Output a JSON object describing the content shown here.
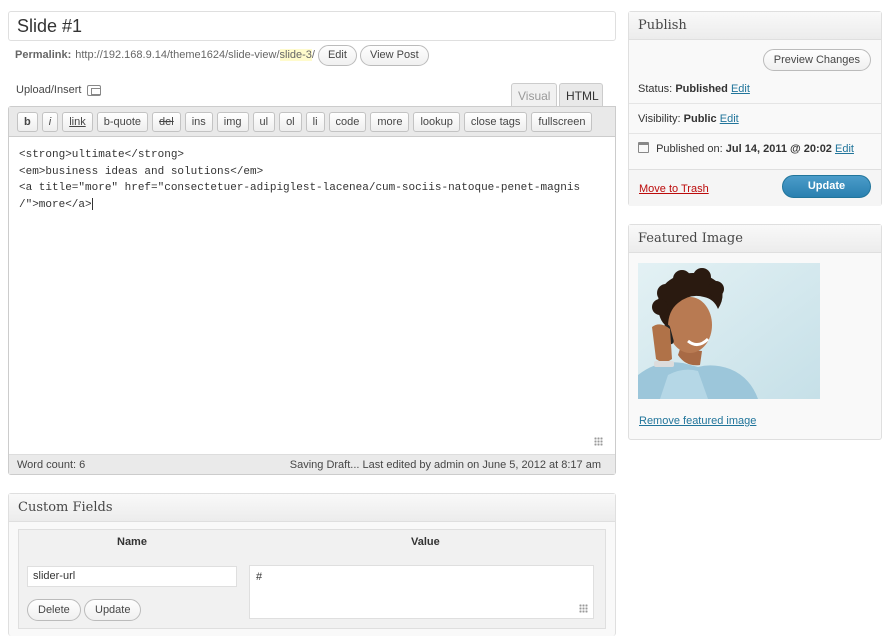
{
  "editor": {
    "title": "Slide #1",
    "permalink": {
      "label": "Permalink:",
      "base_url": "http://192.168.9.14/theme1624/slide-view/",
      "slug": "slide-3",
      "trailing": "/",
      "edit_label": "Edit",
      "view_label": "View Post"
    },
    "upload_insert_label": "Upload/Insert",
    "tabs": {
      "visual": "Visual",
      "html": "HTML",
      "active": "HTML"
    },
    "quicktags": [
      "b",
      "i",
      "link",
      "b-quote",
      "del",
      "ins",
      "img",
      "ul",
      "ol",
      "li",
      "code",
      "more",
      "lookup",
      "close tags",
      "fullscreen"
    ],
    "content_lines": [
      "<strong>ultimate</strong>",
      "<em>business ideas and solutions</em>",
      "<a title=\"more\" href=\"consectetuer-adipiglest-lacenea/cum-sociis-natoque-penet-magnis",
      "/\">more</a>"
    ],
    "word_count": "Word count: 6",
    "status_text": "Saving Draft... Last edited by admin on June 5, 2012 at 8:17 am"
  },
  "custom_fields": {
    "title": "Custom Fields",
    "name_header": "Name",
    "value_header": "Value",
    "name_value": "slider-url",
    "value_value": "#",
    "delete_label": "Delete",
    "update_label": "Update"
  },
  "publish": {
    "title": "Publish",
    "preview_label": "Preview Changes",
    "status_label": "Status:",
    "status_value": "Published",
    "visibility_label": "Visibility:",
    "visibility_value": "Public",
    "published_label": "Published on:",
    "published_value": "Jul 14, 2011 @ 20:02",
    "edit_label": "Edit",
    "trash_label": "Move to Trash",
    "update_label": "Update",
    "update_color": "#2a80b0",
    "trash_color": "#bc0b0b"
  },
  "featured": {
    "title": "Featured Image",
    "remove_label": "Remove featured image"
  }
}
